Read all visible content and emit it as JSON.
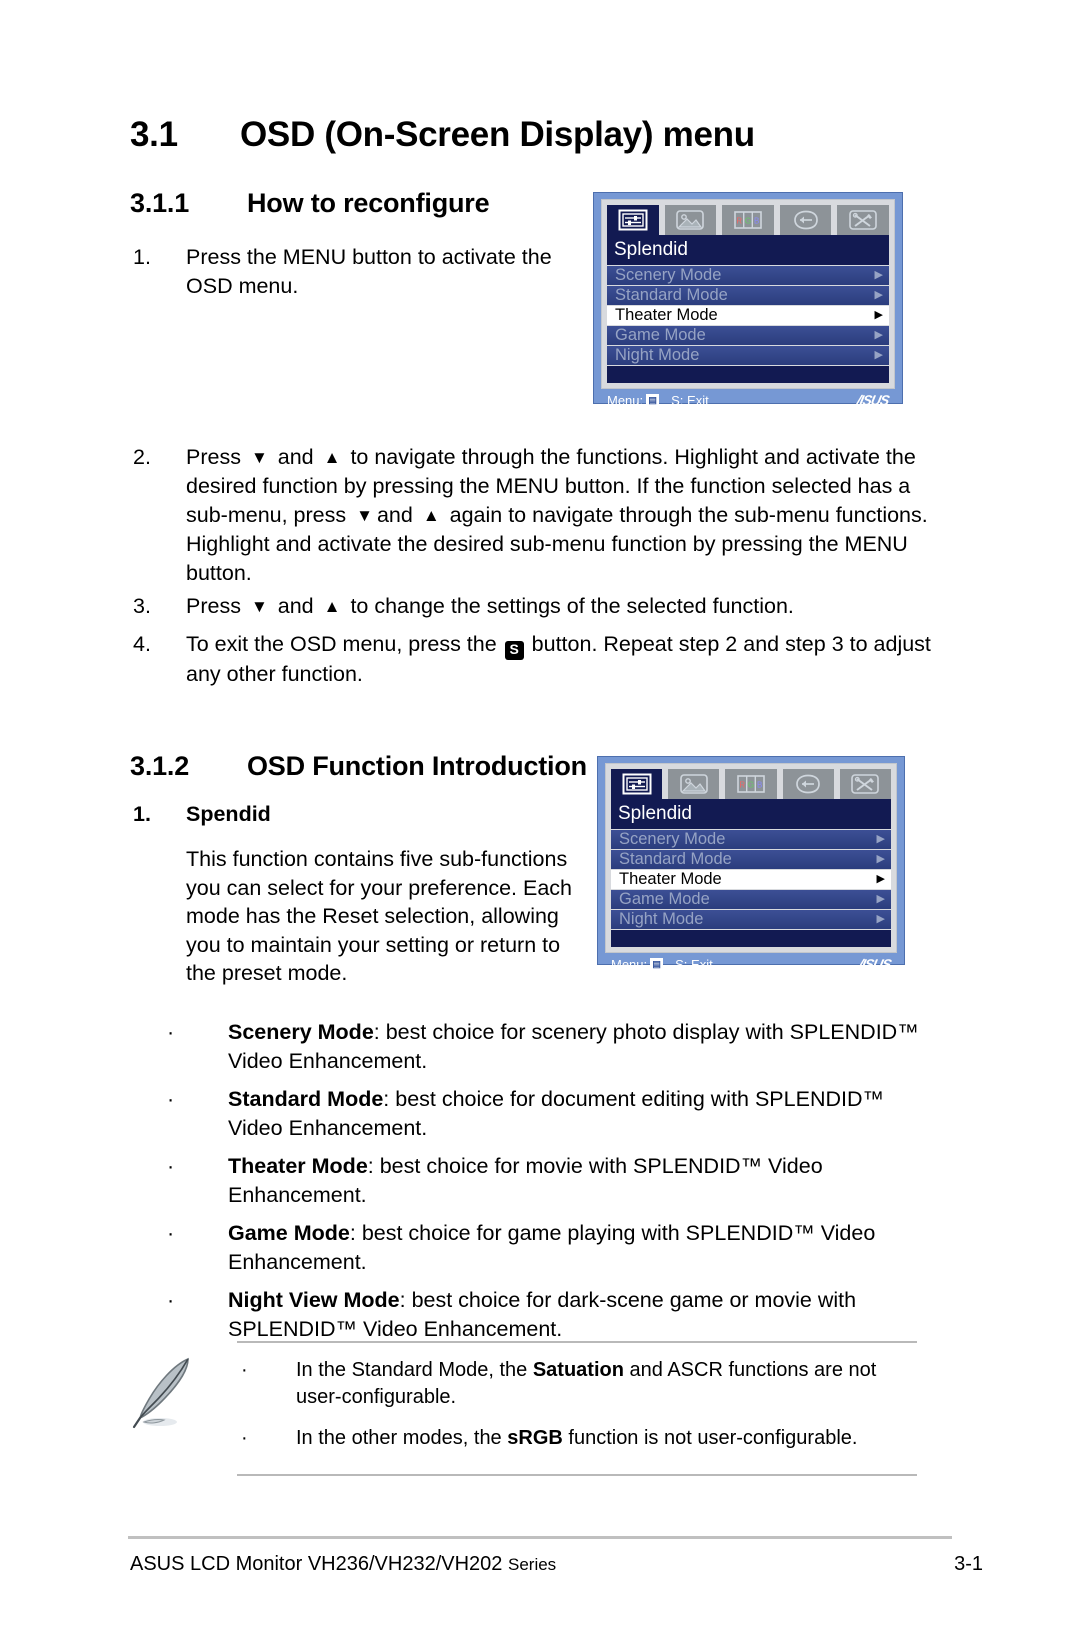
{
  "section": {
    "number": "3.1",
    "title": "OSD (On-Screen Display) menu"
  },
  "subsection_1": {
    "number": "3.1.1",
    "title": "How to reconfigure"
  },
  "subsection_2": {
    "number": "3.1.2",
    "title": "OSD Function Introduction"
  },
  "steps": [
    {
      "index": "1.",
      "text": "Press the MENU button to activate the OSD menu."
    },
    {
      "index": "2.",
      "p1": "Press",
      "down": "▼",
      "a1": "and",
      "up": "▲",
      "p2": "to navigate through the functions. Highlight and activate the desired function by pressing the MENU button. If the function selected has a sub-menu, press",
      "down2": "▼",
      "a2": "and",
      "up2": "▲",
      "p3": "again to navigate through the sub-menu functions. Highlight and activate the desired sub-menu function by pressing the MENU button."
    },
    {
      "index": "3.",
      "p1": "Press",
      "down": "▼",
      "a1": "and",
      "up": "▲",
      "p2": "to change the settings of the selected function."
    },
    {
      "index": "4.",
      "p1": "To exit the OSD menu, press the",
      "button_glyph": "S",
      "p2": "button. Repeat step 2 and step 3 to adjust any other function."
    }
  ],
  "function_item": {
    "index": "1.",
    "title": "Spendid",
    "paragraph": "This function contains five sub-functions you can select for your preference. Each mode has the Reset selection, allowing you to maintain your setting or return to the preset mode."
  },
  "bullets": [
    {
      "dot": "·",
      "bold": "Scenery Mode",
      "rest": ": best choice for scenery photo display with SPLENDID™ Video Enhancement."
    },
    {
      "dot": "·",
      "bold": "Standard Mode",
      "rest": ": best choice for document editing with SPLENDID™ Video Enhancement."
    },
    {
      "dot": "·",
      "bold": "Theater Mode",
      "rest": ": best choice for movie with SPLENDID™ Video Enhancement."
    },
    {
      "dot": "·",
      "bold": "Game Mode",
      "rest": ": best choice for game playing with SPLENDID™ Video Enhancement."
    },
    {
      "dot": "·",
      "bold": "Night View Mode",
      "rest": ": best choice for dark-scene game or movie with SPLENDID™ Video Enhancement."
    }
  ],
  "note": {
    "icon": "quill-pen-icon",
    "items": [
      {
        "dot": "·",
        "pre": "In the Standard Mode, the ",
        "bold": "Satuation",
        "post": " and ASCR functions are not user-configurable."
      },
      {
        "dot": "·",
        "pre": "In the other modes, the ",
        "bold": "sRGB",
        "post": " function is not user-configurable."
      }
    ]
  },
  "footer": {
    "left": "ASUS LCD Monitor  ",
    "series_models": "VH236/VH232/VH202 ",
    "series_word": "Series",
    "page": "3-1"
  },
  "osd": {
    "tabs": [
      {
        "name": "splendid-tab",
        "active": true
      },
      {
        "name": "image-tab",
        "active": false
      },
      {
        "name": "color-tab",
        "active": false
      },
      {
        "name": "input-select-tab",
        "active": false
      },
      {
        "name": "system-setup-tab",
        "active": false
      }
    ],
    "title": "Splendid",
    "rows": [
      {
        "label": "Scenery Mode",
        "caret": "▶",
        "selected": false
      },
      {
        "label": "Standard Mode",
        "caret": "▶",
        "selected": false
      },
      {
        "label": "Theater Mode",
        "caret": "▶",
        "selected": true
      },
      {
        "label": "Game Mode",
        "caret": "▶",
        "selected": false
      },
      {
        "label": "Night Mode",
        "caret": "▶",
        "selected": false
      }
    ],
    "footer": {
      "menu_label": "Menu:",
      "menu_icon_glyph": "☰",
      "exit_label": "S: Exit",
      "brand": "/ISUS"
    },
    "colors": {
      "frame": "#7698d4",
      "panel": "#d8dade",
      "title_bg": "#121a52",
      "row_bg": "#3c4f95",
      "row_text": "#96a3c4",
      "selected_bg": "#ffffff",
      "tab_bg": "#8d9398"
    }
  }
}
